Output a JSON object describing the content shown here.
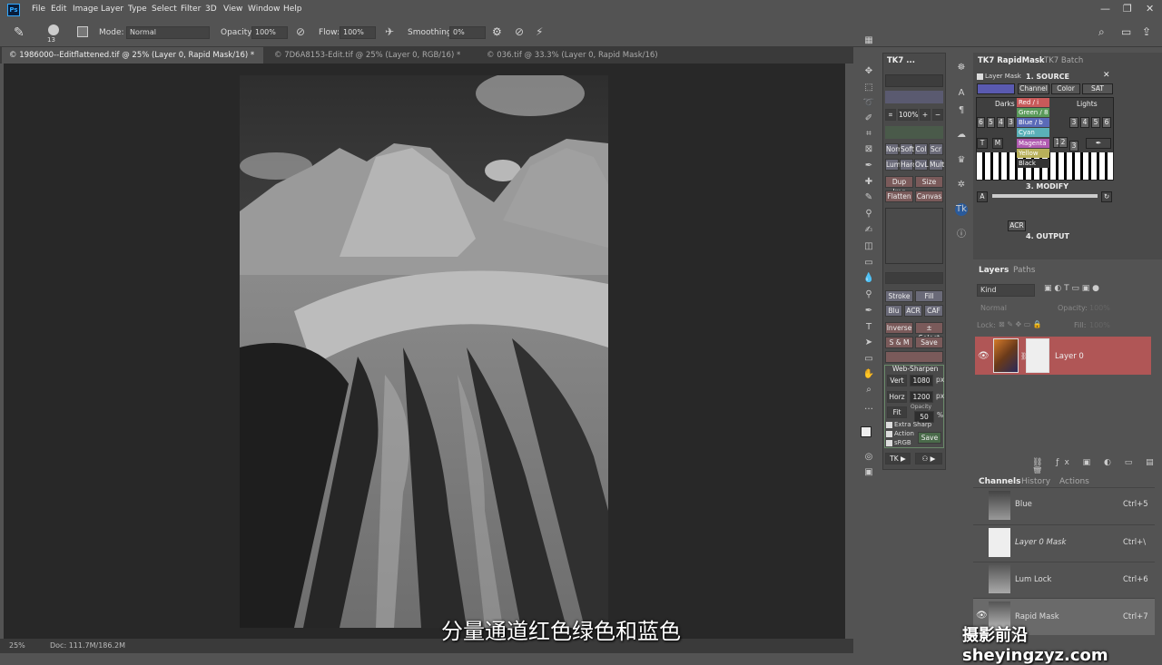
{
  "menubar": {
    "logo": "Ps",
    "items": [
      "File",
      "Edit",
      "Image",
      "Layer",
      "Type",
      "Select",
      "Filter",
      "3D",
      "View",
      "Window",
      "Help"
    ]
  },
  "options": {
    "brush_size": "13",
    "mode_label": "Mode:",
    "mode_value": "Normal",
    "opacity_label": "Opacity:",
    "opacity_value": "100%",
    "flow_label": "Flow:",
    "flow_value": "100%",
    "smoothing_label": "Smoothing:",
    "smoothing_value": "0%"
  },
  "tabs": [
    {
      "label": "© 1986000--Editflattened.tif @ 25% (Layer 0, Rapid Mask/16) *"
    },
    {
      "label": "© 7D6A8153-Edit.tif @ 25% (Layer 0, RGB/16) *"
    },
    {
      "label": "© 036.tif @ 33.3% (Layer 0, Rapid Mask/16) *"
    }
  ],
  "status": {
    "zoom": "25%",
    "doc": "Doc: 111.7M/186.2M"
  },
  "tk7": {
    "title": "TK7 ...",
    "zoom": "100%",
    "row_norm": [
      "Norm",
      "Soft",
      "Col",
      "Scr"
    ],
    "row_lum": [
      "Lum",
      "Hard",
      "OvL",
      "Mult"
    ],
    "row_dup": [
      "Dup Img",
      "Size"
    ],
    "row_flat": [
      "Flatten",
      "Canvas"
    ],
    "row_stroke": [
      "Stroke",
      "Fill"
    ],
    "row_blu": [
      "Blu",
      "ACR",
      "CAF"
    ],
    "row_inv": [
      "Inverse",
      "± Select"
    ],
    "row_sm": [
      "S & M",
      "Save"
    ],
    "websharpen_title": "Web-Sharpen",
    "vert_label": "Vert",
    "vert_value": "1080",
    "horz_label": "Horz",
    "horz_value": "1200",
    "px": "px",
    "fit": "Fit",
    "opacity_label": "Opacity",
    "opacity_value": "50",
    "percent": "%",
    "extra_sharp": "Extra Sharp",
    "action": "Action",
    "srgb": "sRGB",
    "save": "Save",
    "tk_button": "TK ▶"
  },
  "rapidmask": {
    "tab1": "TK7 RapidMask",
    "tab2": "TK7 Batch",
    "layer_mask": "Layer Mask",
    "source_title": "1. SOURCE",
    "channel": "Channel",
    "color": "Color",
    "sat": "SAT",
    "darks": "Darks",
    "lights": "Lights",
    "modify_title": "3. MODIFY",
    "output_title": "4. OUTPUT",
    "acr": "ACR",
    "num_left": [
      "6",
      "5",
      "4",
      "3"
    ],
    "num_right": [
      "3",
      "4",
      "5",
      "6"
    ],
    "num_mid": [
      "1",
      "2",
      "3"
    ],
    "dropdown": [
      {
        "label": "Red / i",
        "color": "#c85a5a"
      },
      {
        "label": "Green / 8",
        "color": "#5a9a5a"
      },
      {
        "label": "Blue / b",
        "color": "#5a6ab8"
      },
      {
        "label": "Cyan",
        "color": "#5ab0b8"
      },
      {
        "label": "Magenta",
        "color": "#b05ab0"
      },
      {
        "label": "Yellow",
        "color": "#b8b05a"
      },
      {
        "label": "Black",
        "color": "#333333"
      }
    ]
  },
  "layers": {
    "tab1": "Layers",
    "tab2": "Paths",
    "kind": "Kind",
    "blend": "Normal",
    "opacity_label": "Opacity:",
    "opacity_value": "100%",
    "lock_label": "Lock:",
    "fill_label": "Fill:",
    "fill_value": "100%",
    "layer_name": "Layer 0"
  },
  "channels": {
    "tab1": "Channels",
    "tab2": "History",
    "tab3": "Actions",
    "rows": [
      {
        "name": "Blue",
        "key": "Ctrl+5"
      },
      {
        "name": "Layer 0 Mask",
        "key": "Ctrl+\\"
      },
      {
        "name": "Lum Lock",
        "key": "Ctrl+6"
      },
      {
        "name": "Rapid Mask",
        "key": "Ctrl+7"
      }
    ]
  },
  "subtitle": "分量通道红色绿色和蓝色",
  "watermark": "摄影前沿 sheyingzyz.com"
}
